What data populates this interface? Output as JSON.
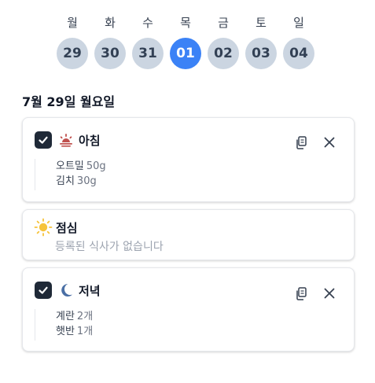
{
  "week": {
    "days": [
      "월",
      "화",
      "수",
      "목",
      "금",
      "토",
      "일"
    ],
    "dates": [
      "29",
      "30",
      "31",
      "01",
      "02",
      "03",
      "04"
    ],
    "active_index": 3
  },
  "selected_day_title": "7월 29일 월요일",
  "meals": {
    "breakfast": {
      "title": "아침",
      "checked": true,
      "icon": "sunrise-icon",
      "items": [
        {
          "name": "오트밀",
          "amount": "50g"
        },
        {
          "name": "김치",
          "amount": "30g"
        }
      ]
    },
    "lunch": {
      "title": "점심",
      "icon": "sun-icon",
      "empty_text": "등록된 식사가 없습니다"
    },
    "dinner": {
      "title": "저녁",
      "checked": true,
      "icon": "moon-icon",
      "items": [
        {
          "name": "계란",
          "amount": "2개"
        },
        {
          "name": "햇반",
          "amount": "1개"
        }
      ]
    }
  },
  "colors": {
    "accent": "#3b82f6",
    "date_inactive": "#cbd5e1",
    "checkbox": "#1f2937",
    "sunrise": "#c0504d",
    "sun": "#f6c33b",
    "moon": "#4a6fa5"
  }
}
